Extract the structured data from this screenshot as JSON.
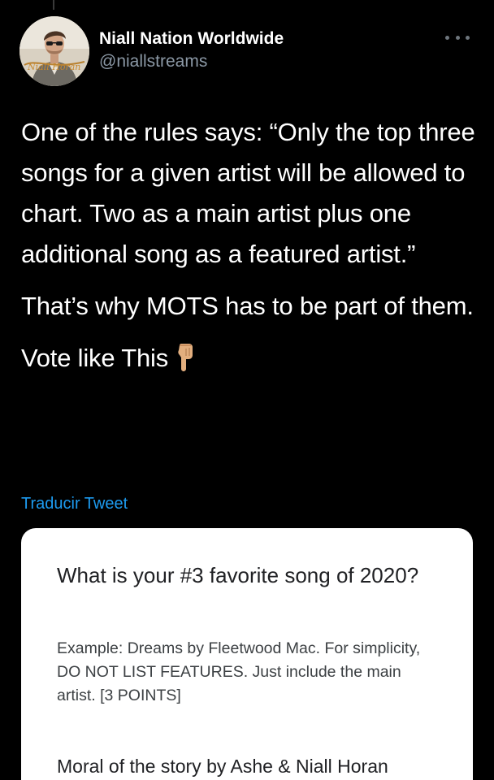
{
  "tweet": {
    "author_name": "Niall Nation Worldwide",
    "author_handle": "@niallstreams",
    "avatar_caption": "Niall Horan",
    "paragraphs": [
      "One of the rules says: “Only the top three songs for a given artist will be allowed to chart. Two as a main artist plus one additional song as a featured artist.”",
      "That’s why MOTS has to be part of them.",
      "Vote like This"
    ],
    "vote_emoji": "backhand-index-pointing-down",
    "translate_label": "Traducir Tweet"
  },
  "form_card": {
    "question": "What is your #3 favorite song of 2020?",
    "hint": "Example: Dreams by Fleetwood Mac. For simplicity, DO NOT LIST FEATURES. Just include the main artist. [3 POINTS]",
    "answer": "Moral of the story by Ashe & Niall Horan"
  },
  "colors": {
    "background": "#000000",
    "text_primary": "#ffffff",
    "text_secondary": "#8b98a5",
    "link": "#1d9bf0",
    "card_background": "#ffffff"
  }
}
